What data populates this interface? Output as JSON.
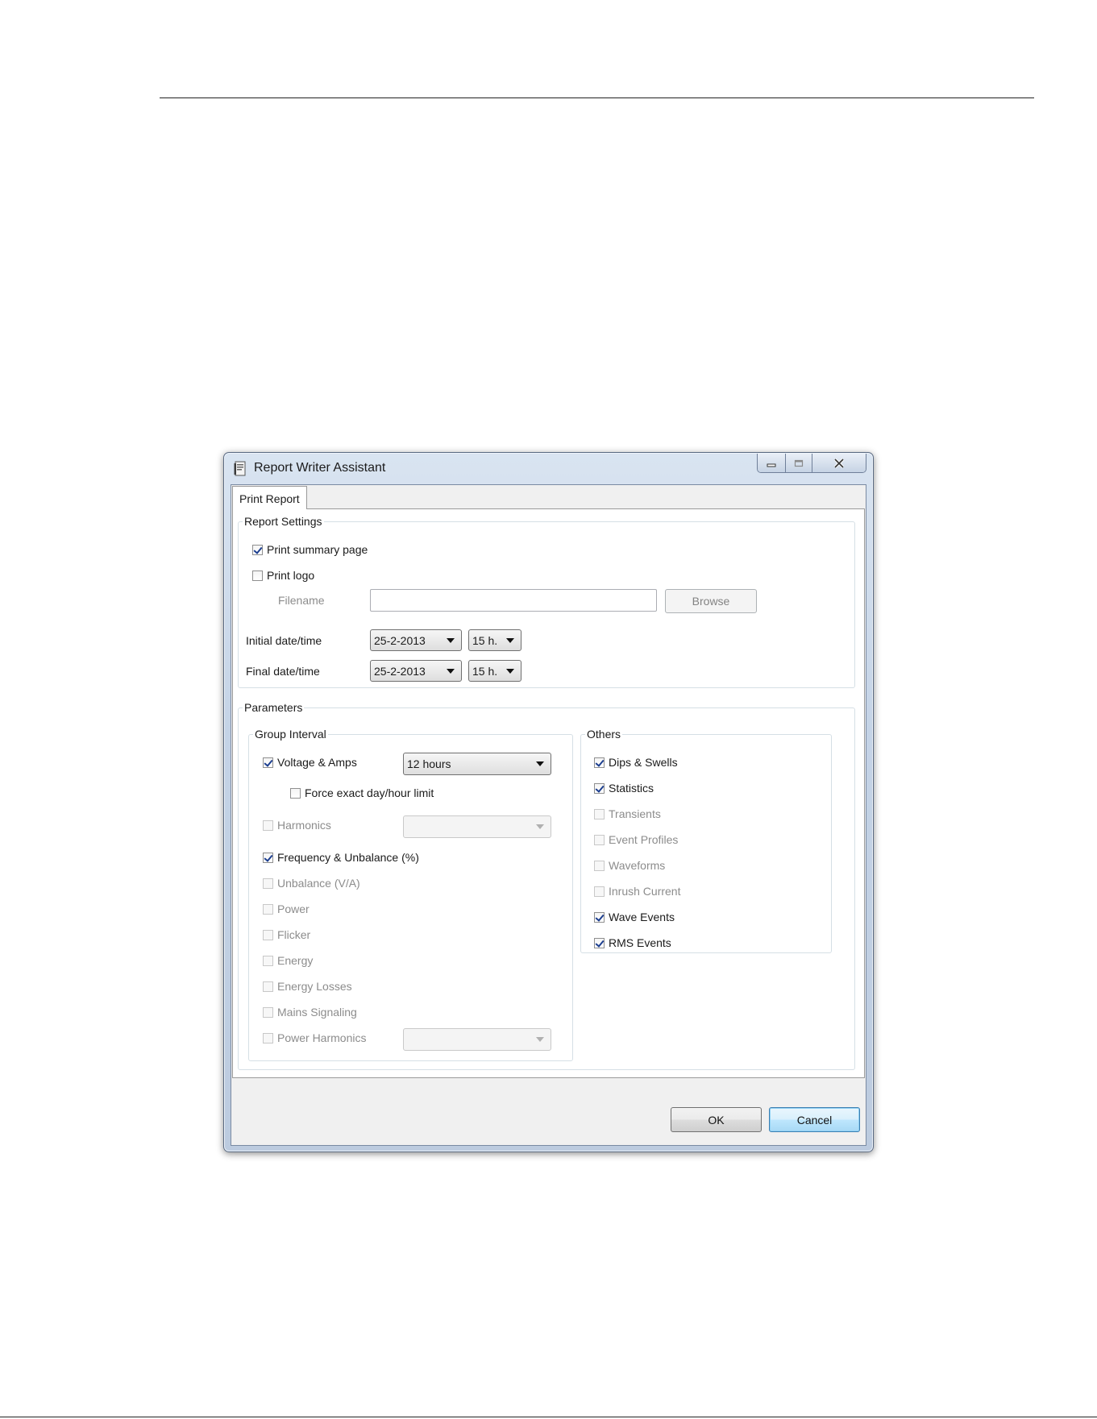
{
  "window": {
    "title": "Report Writer Assistant"
  },
  "tab": {
    "label": "Print Report"
  },
  "report_settings": {
    "legend": "Report Settings",
    "print_summary_page": {
      "label": "Print summary page",
      "checked": true
    },
    "print_logo": {
      "label": "Print logo",
      "checked": false
    },
    "filename_label": "Filename",
    "filename_value": "",
    "browse_label": "Browse",
    "initial_label": "Initial date/time",
    "initial_date": "25-2-2013",
    "initial_hour": "15 h.",
    "final_label": "Final date/time",
    "final_date": "25-2-2013",
    "final_hour": "15 h."
  },
  "parameters": {
    "legend": "Parameters",
    "group_interval": {
      "legend": "Group Interval",
      "voltage_amps": {
        "label": "Voltage & Amps",
        "checked": true,
        "interval": "12 hours"
      },
      "force_exact": {
        "label": "Force exact day/hour limit",
        "checked": false
      },
      "harmonics": {
        "label": "Harmonics",
        "checked": false,
        "enabled": false
      },
      "frequency_unbalance": {
        "label": "Frequency & Unbalance (%)",
        "checked": true
      },
      "unbalance_va": {
        "label": "Unbalance (V/A)",
        "checked": false,
        "enabled": false
      },
      "power": {
        "label": "Power",
        "checked": false,
        "enabled": false
      },
      "flicker": {
        "label": "Flicker",
        "checked": false,
        "enabled": false
      },
      "energy": {
        "label": "Energy",
        "checked": false,
        "enabled": false
      },
      "energy_losses": {
        "label": "Energy Losses",
        "checked": false,
        "enabled": false
      },
      "mains_signaling": {
        "label": "Mains Signaling",
        "checked": false,
        "enabled": false
      },
      "power_harmonics": {
        "label": "Power Harmonics",
        "checked": false,
        "enabled": false
      }
    },
    "others": {
      "legend": "Others",
      "dips_swells": {
        "label": "Dips & Swells",
        "checked": true
      },
      "statistics": {
        "label": "Statistics",
        "checked": true
      },
      "transients": {
        "label": "Transients",
        "checked": false,
        "enabled": false
      },
      "event_profiles": {
        "label": "Event Profiles",
        "checked": false,
        "enabled": false
      },
      "waveforms": {
        "label": "Waveforms",
        "checked": false,
        "enabled": false
      },
      "inrush_current": {
        "label": "Inrush Current",
        "checked": false,
        "enabled": false
      },
      "wave_events": {
        "label": "Wave Events",
        "checked": true
      },
      "rms_events": {
        "label": "RMS Events",
        "checked": true
      }
    }
  },
  "buttons": {
    "ok": "OK",
    "cancel": "Cancel"
  },
  "colors": {
    "title_bar": "#c4d3e6",
    "check_mark": "#1c3e8f",
    "default_button": "#bee6fd"
  }
}
